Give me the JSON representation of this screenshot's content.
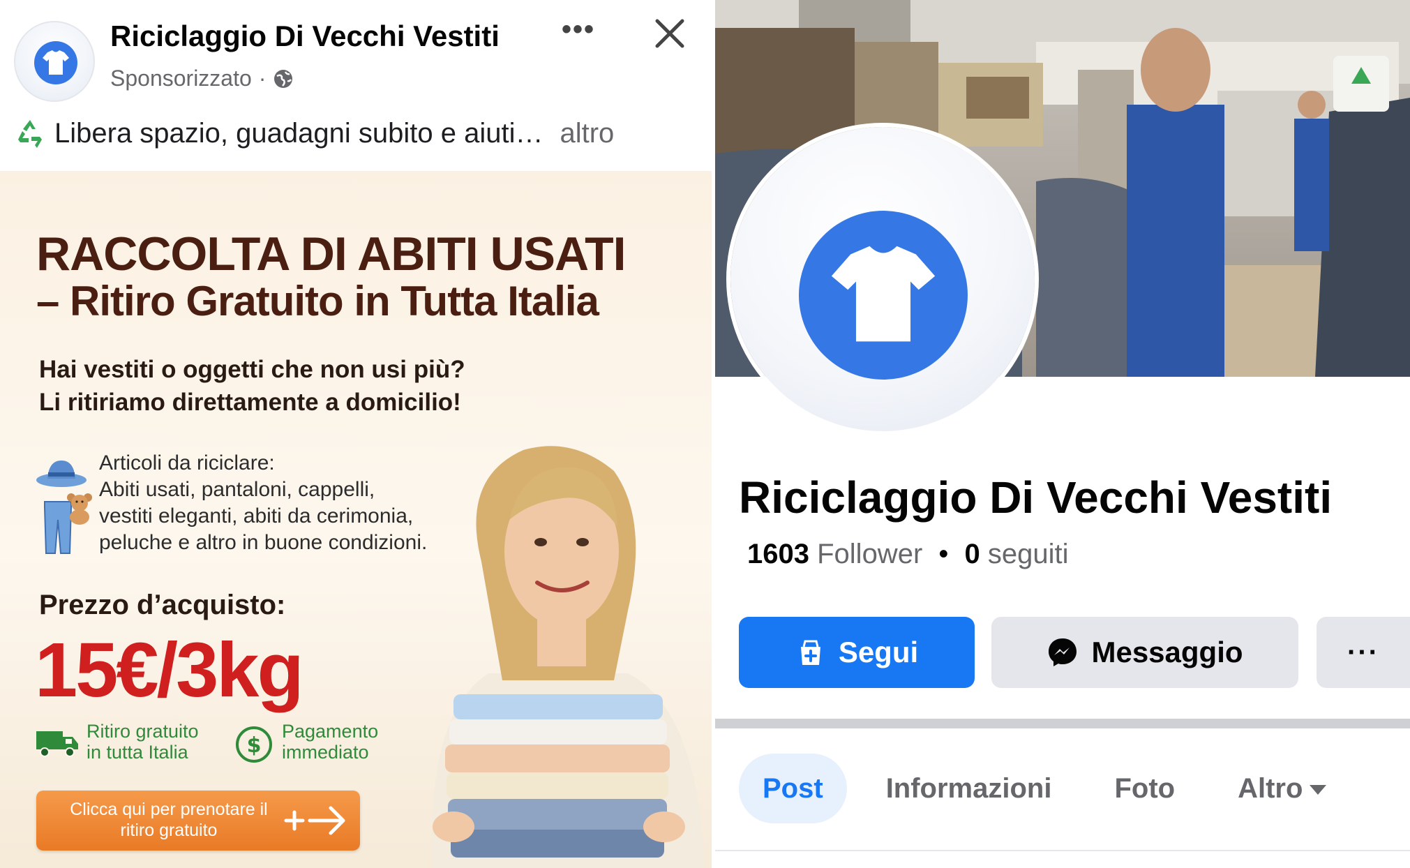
{
  "post": {
    "page_name": "Riciclaggio Di Vecchi Vestiti",
    "sponsored": "Sponsorizzato",
    "separator": "·",
    "more_label": "•••",
    "caption": "Libera spazio, guadagni subito e aiuti…",
    "caption_more": "altro",
    "icons": [
      "tshirt-icon",
      "globe-icon",
      "more-icon",
      "close-icon",
      "recycle-icon"
    ]
  },
  "ad": {
    "title_line1": "RACCOLTA DI ABITI USATI",
    "title_line2": "– Ritiro Gratuito in Tutta Italia",
    "subtitle_line1": "Hai vestiti o oggetti che non usi più?",
    "subtitle_line2": "Li ritiriamo direttamente a domicilio!",
    "items_heading": "Articoli da riciclare:",
    "items_line1": "Abiti usati, pantaloni, cappelli,",
    "items_line2": "vestiti eleganti, abiti da cerimonia,",
    "items_line3": "peluche e altro in buone condizioni.",
    "price_label": "Prezzo d’acquisto:",
    "price_value": "15€/3kg",
    "feature1_line1": "Ritiro gratuito",
    "feature1_line2": "in tutta Italia",
    "feature2_line1": "Pagamento",
    "feature2_line2": "immediato",
    "cta_line1": "Clicca qui per prenotare il",
    "cta_line2": "ritiro gratuito",
    "colors": {
      "title": "#4a1f12",
      "price": "#cf1f1f",
      "feature": "#2f8a3a",
      "cta": "#e97a26"
    }
  },
  "profile": {
    "name": "Riciclaggio Di Vecchi Vestiti",
    "followers_count": "1603",
    "followers_label": "Follower",
    "dot": "•",
    "following_count": "0",
    "following_label": "seguiti",
    "follow_button": "Segui",
    "message_button": "Messaggio",
    "more_button": "···",
    "tabs": [
      {
        "label": "Post",
        "active": true
      },
      {
        "label": "Informazioni",
        "active": false
      },
      {
        "label": "Foto",
        "active": false
      },
      {
        "label": "Altro",
        "active": false
      }
    ],
    "colors": {
      "primary": "#1877f2",
      "avatar": "#3578e5"
    }
  }
}
